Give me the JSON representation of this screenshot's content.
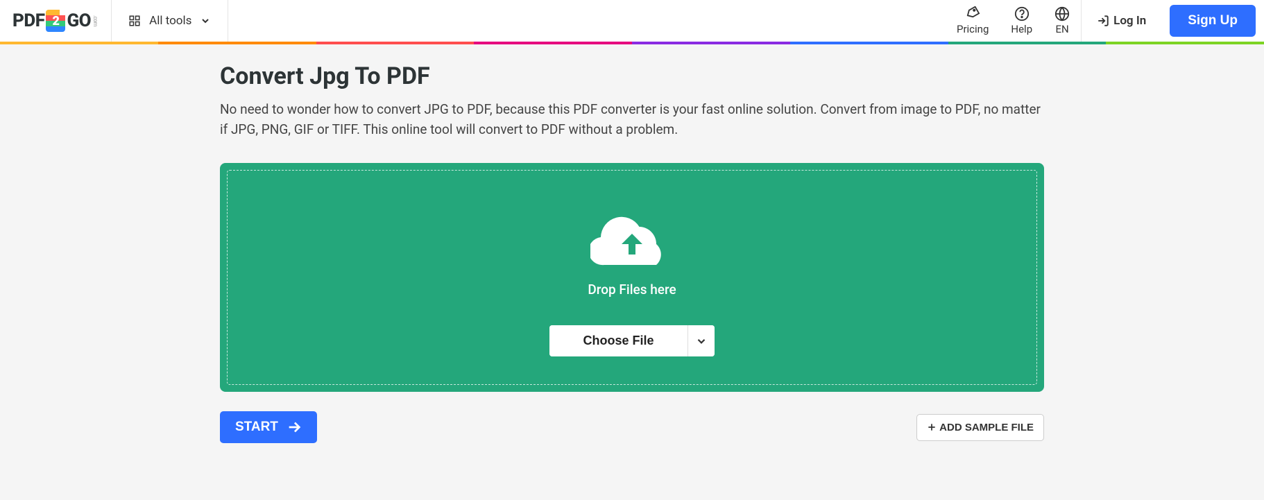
{
  "logo": {
    "left": "PDF",
    "right": "GO",
    "num": "2",
    "com": ".com"
  },
  "nav": {
    "alltools": "All tools",
    "pricing": "Pricing",
    "help": "Help",
    "lang": "EN",
    "login": "Log In",
    "signup": "Sign Up"
  },
  "rainbow": [
    "#ffb830",
    "#ff8a00",
    "#ff4e4e",
    "#e6007e",
    "#8a2be2",
    "#2e6eff",
    "#24a77b",
    "#7dd424"
  ],
  "page": {
    "title": "Convert Jpg To PDF",
    "subtitle": "No need to wonder how to convert JPG to PDF, because this PDF converter is your fast online solution. Convert from image to PDF, no matter if JPG, PNG, GIF or TIFF. This online tool will convert to PDF without a problem."
  },
  "dropzone": {
    "drop_text": "Drop Files here",
    "choose": "Choose File"
  },
  "actions": {
    "start": "START",
    "sample": "ADD SAMPLE FILE"
  }
}
